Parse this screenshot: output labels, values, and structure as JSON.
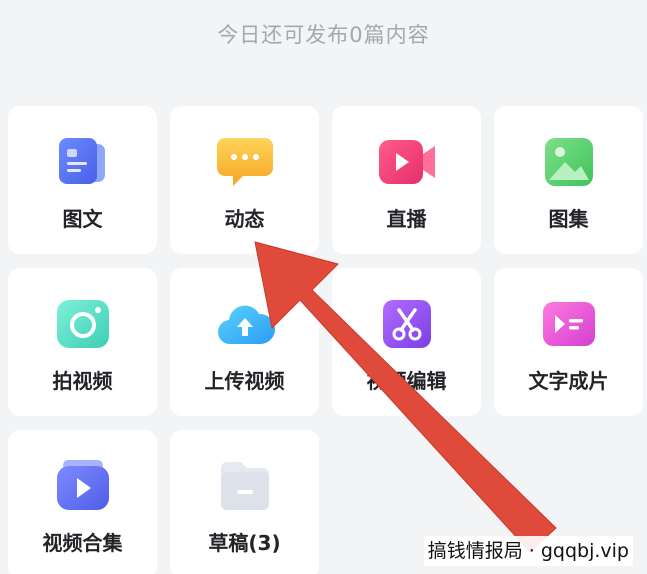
{
  "notice": "今日还可发布0篇内容",
  "tiles": [
    {
      "label": "图文",
      "icon": "document-icon"
    },
    {
      "label": "动态",
      "icon": "chat-bubble-icon"
    },
    {
      "label": "直播",
      "icon": "video-camera-icon"
    },
    {
      "label": "图集",
      "icon": "image-gallery-icon"
    },
    {
      "label": "拍视频",
      "icon": "camera-icon"
    },
    {
      "label": "上传视频",
      "icon": "cloud-upload-icon"
    },
    {
      "label": "视频编辑",
      "icon": "scissors-icon"
    },
    {
      "label": "文字成片",
      "icon": "text-to-video-icon"
    },
    {
      "label": "视频合集",
      "icon": "video-collection-icon"
    },
    {
      "label": "草稿(3)",
      "icon": "folder-icon"
    }
  ],
  "colors": {
    "background": "#f3f4f6",
    "tile": "#ffffff",
    "arrow": "#e04a3a",
    "notice_text": "#a4a7ad"
  },
  "watermark": "搞钱情报局 · gqqbj.vip"
}
